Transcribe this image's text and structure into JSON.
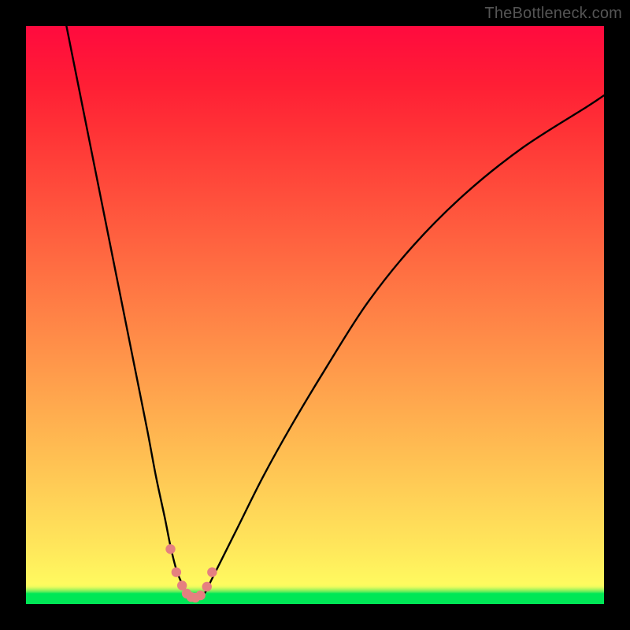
{
  "watermark": "TheBottleneck.com",
  "chart_data": {
    "type": "line",
    "title": "",
    "xlabel": "",
    "ylabel": "",
    "xlim": [
      0,
      100
    ],
    "ylim": [
      0,
      100
    ],
    "series": [
      {
        "name": "curve",
        "x": [
          7,
          9,
          11,
          13,
          15,
          17,
          19,
          21,
          22.5,
          24,
          25,
          26,
          27,
          27.8,
          28.5,
          29.2,
          30,
          31,
          32,
          34,
          37,
          41,
          46,
          52,
          59,
          67,
          76,
          86,
          97,
          100
        ],
        "y": [
          100,
          90,
          80,
          70,
          60,
          50,
          40,
          30,
          22,
          15,
          10,
          6,
          3.5,
          2,
          1.2,
          1,
          1.2,
          2,
          4,
          8,
          14,
          22,
          31,
          41,
          52,
          62,
          71,
          79,
          86,
          88
        ]
      },
      {
        "name": "dots",
        "x": [
          25.0,
          26.0,
          27.0,
          27.8,
          28.6,
          29.3,
          30.2,
          31.3,
          32.2
        ],
        "y": [
          9.5,
          5.5,
          3.2,
          1.8,
          1.2,
          1.1,
          1.5,
          3.0,
          5.5
        ]
      }
    ],
    "colors": {
      "curve": "#000000",
      "dots": "#e58080",
      "gradient_top": "#ff0a3e",
      "gradient_mid": "#ffd257",
      "gradient_bottom": "#00e756"
    }
  }
}
